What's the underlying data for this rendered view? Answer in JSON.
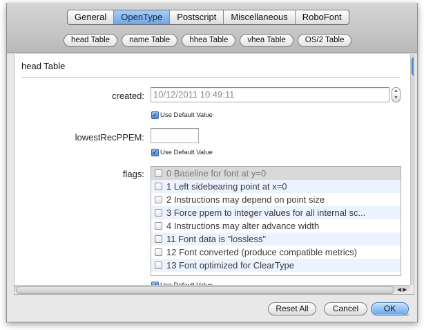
{
  "tabs": [
    {
      "label": "General",
      "active": false
    },
    {
      "label": "OpenType",
      "active": true
    },
    {
      "label": "Postscript",
      "active": false
    },
    {
      "label": "Miscellaneous",
      "active": false
    },
    {
      "label": "RoboFont",
      "active": false
    }
  ],
  "subtabs": [
    "head Table",
    "name Table",
    "hhea Table",
    "vhea Table",
    "OS/2 Table"
  ],
  "section": {
    "title": "head Table"
  },
  "fields": {
    "created": {
      "label": "created:",
      "value": "10/12/2011 10:49:11",
      "use_default_label": "Use Default Value",
      "use_default": true
    },
    "lowestRecPPEM": {
      "label": "lowestRecPPEM:",
      "value": "",
      "use_default_label": "Use Default Value",
      "use_default": true
    },
    "flags": {
      "label": "flags:",
      "use_default_label": "Use Default Value",
      "use_default": true,
      "items": [
        {
          "label": "0 Baseline for font at y=0",
          "checked": false
        },
        {
          "label": "1 Left sidebearing point at x=0",
          "checked": false
        },
        {
          "label": "2 Instructions may depend on point size",
          "checked": false
        },
        {
          "label": "3 Force ppem to integer values for all internal sc...",
          "checked": false
        },
        {
          "label": "4 Instructions may alter advance width",
          "checked": false
        },
        {
          "label": "11 Font data is \"lossless\"",
          "checked": false
        },
        {
          "label": "12 Font converted (produce compatible metrics)",
          "checked": false
        },
        {
          "label": "13 Font optimized for ClearType",
          "checked": false
        }
      ]
    }
  },
  "buttons": {
    "reset_all": "Reset All",
    "cancel": "Cancel",
    "ok": "OK"
  },
  "icons": {
    "check": "checkmark-icon",
    "up": "arrow-up-icon",
    "down": "arrow-down-icon"
  },
  "colors": {
    "accent": "#6fa6e8",
    "alt_row": "#edf3fe"
  }
}
